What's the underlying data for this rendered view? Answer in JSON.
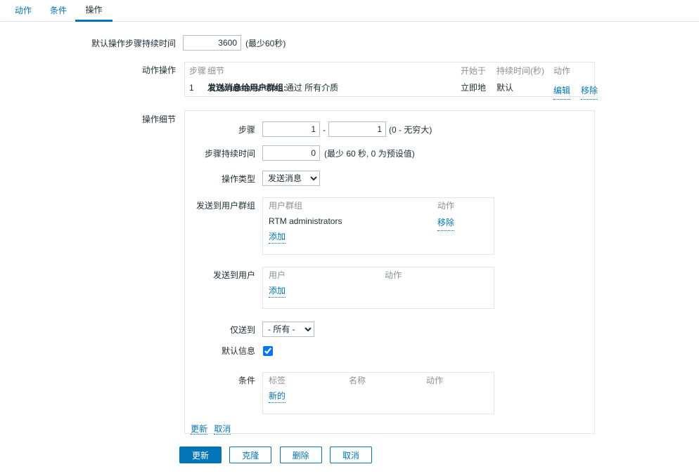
{
  "tabs": [
    {
      "id": "action",
      "label": "动作",
      "active": false
    },
    {
      "id": "condition",
      "label": "条件",
      "active": false
    },
    {
      "id": "operation",
      "label": "操作",
      "active": true
    }
  ],
  "default_step_duration": {
    "label": "默认操作步骤持续时间",
    "value": "3600",
    "hint": "(最少60秒)"
  },
  "operations": {
    "label": "动作操作",
    "headers": {
      "step": "步骤",
      "details": "细节",
      "start_in": "开始于",
      "duration": "持续时间(秒)",
      "action": "动作"
    },
    "rows": [
      {
        "step": "1",
        "detail_bold": "发送消息给用户群组:",
        "detail_rest": "RTM administrators 通过 所有介质",
        "start_in": "立即地",
        "duration": "默认",
        "edit_label": "编辑",
        "remove_label": "移除"
      }
    ]
  },
  "operation_details": {
    "label": "操作细节",
    "steps": {
      "label": "步骤",
      "from": "1",
      "to": "1",
      "separator": "-",
      "hint": "(0 - 无穷大)"
    },
    "step_duration": {
      "label": "步骤持续时间",
      "value": "0",
      "hint": "(最少 60 秒, 0 为预设值)"
    },
    "operation_type": {
      "label": "操作类型",
      "selected": "发送消息",
      "options": [
        "发送消息"
      ]
    },
    "send_to_user_groups": {
      "label": "发送到用户群组",
      "headers": {
        "name": "用户群组",
        "action": "动作"
      },
      "rows": [
        {
          "name": "RTM administrators",
          "remove_label": "移除"
        }
      ],
      "add_label": "添加"
    },
    "send_to_users": {
      "label": "发送到用户",
      "headers": {
        "name": "用户",
        "action": "动作"
      },
      "rows": [],
      "add_label": "添加"
    },
    "send_only_to": {
      "label": "仅送到",
      "selected": "- 所有 -",
      "options": [
        "- 所有 -"
      ]
    },
    "default_message": {
      "label": "默认信息",
      "checked": true
    },
    "conditions": {
      "label": "条件",
      "headers": {
        "tag": "标签",
        "name": "名称",
        "action": "动作"
      },
      "rows": [],
      "new_label": "新的"
    },
    "update_label": "更新",
    "cancel_label": "取消"
  },
  "footer": {
    "update_label": "更新",
    "clone_label": "克隆",
    "delete_label": "删除",
    "cancel_label": "取消"
  },
  "colors": {
    "accent": "#0275b8",
    "text": "#1f2c33",
    "muted": "#8b9096",
    "border": "#e3e6e8",
    "input_border": "#b8bfc4"
  }
}
